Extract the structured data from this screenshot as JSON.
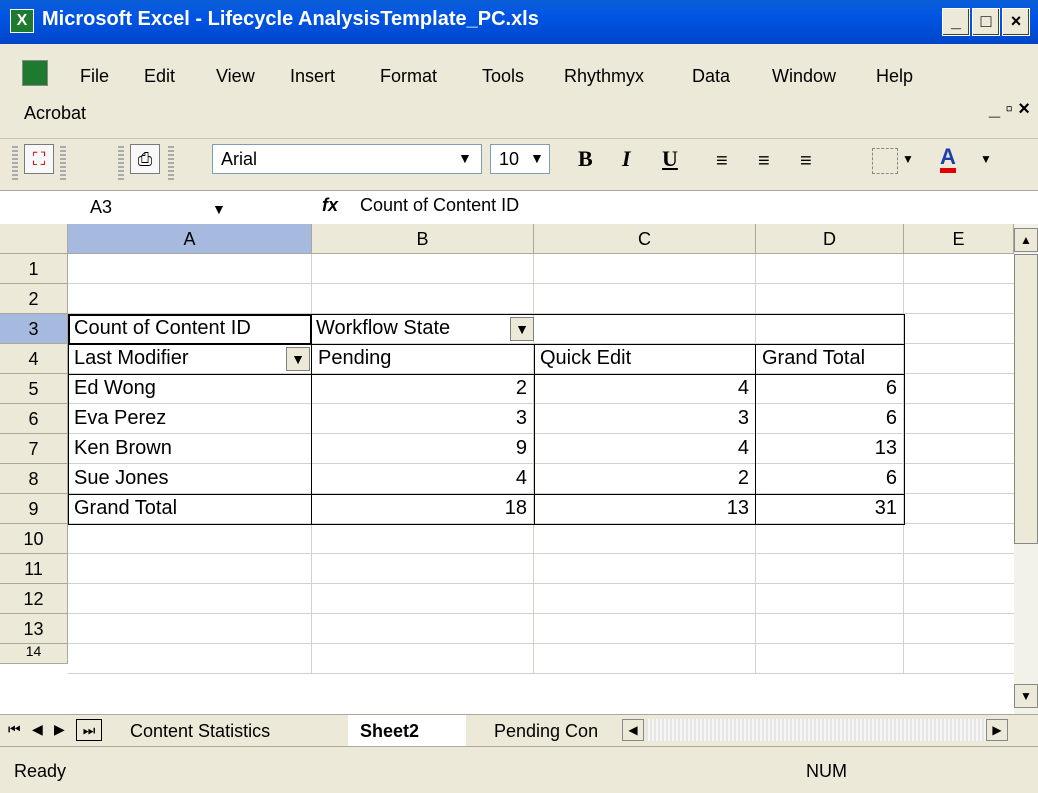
{
  "window": {
    "title": "Microsoft Excel - Lifecycle AnalysisTemplate_PC.xls",
    "buttons": [
      "_",
      "□",
      "×"
    ]
  },
  "menu": {
    "items": [
      "File",
      "Edit",
      "View",
      "Insert",
      "Format",
      "Tools",
      "Rhythmyx",
      "Data",
      "Window",
      "Help"
    ],
    "acrobat": "Acrobat",
    "doc_controls": "_ ▫ ×"
  },
  "toolbar": {
    "font": "Arial",
    "size": "10",
    "bold": "B",
    "italic": "I",
    "underline": "U",
    "font_color": "A"
  },
  "formula_bar": {
    "name_box": "A3",
    "fx": "fx",
    "content": "Count of Content ID"
  },
  "columns": [
    "A",
    "B",
    "C",
    "D",
    "E"
  ],
  "rows": [
    "1",
    "2",
    "3",
    "4",
    "5",
    "6",
    "7",
    "8",
    "9",
    "10",
    "11",
    "12",
    "13",
    "14"
  ],
  "pivot": {
    "data_field": "Count of Content ID",
    "col_field": "Workflow State",
    "row_field": "Last Modifier",
    "col_headers": [
      "Pending",
      "Quick Edit",
      "Grand Total"
    ],
    "rows": [
      {
        "name": "Ed Wong",
        "pending": "2",
        "quick": "4",
        "total": "6"
      },
      {
        "name": "Eva Perez",
        "pending": "3",
        "quick": "3",
        "total": "6"
      },
      {
        "name": "Ken Brown",
        "pending": "9",
        "quick": "4",
        "total": "13"
      },
      {
        "name": "Sue Jones",
        "pending": "4",
        "quick": "2",
        "total": "6"
      }
    ],
    "grand_total": {
      "name": "Grand Total",
      "pending": "18",
      "quick": "13",
      "total": "31"
    }
  },
  "sheets": {
    "tabs": [
      "Content Statistics",
      "Sheet2",
      "Pending Con"
    ],
    "active": "Sheet2"
  },
  "status": {
    "ready": "Ready",
    "num": "NUM"
  },
  "colors": {
    "title_bar": "#0054E3",
    "chrome": "#ECE9D8",
    "selected_header": "#A6B9DE"
  }
}
